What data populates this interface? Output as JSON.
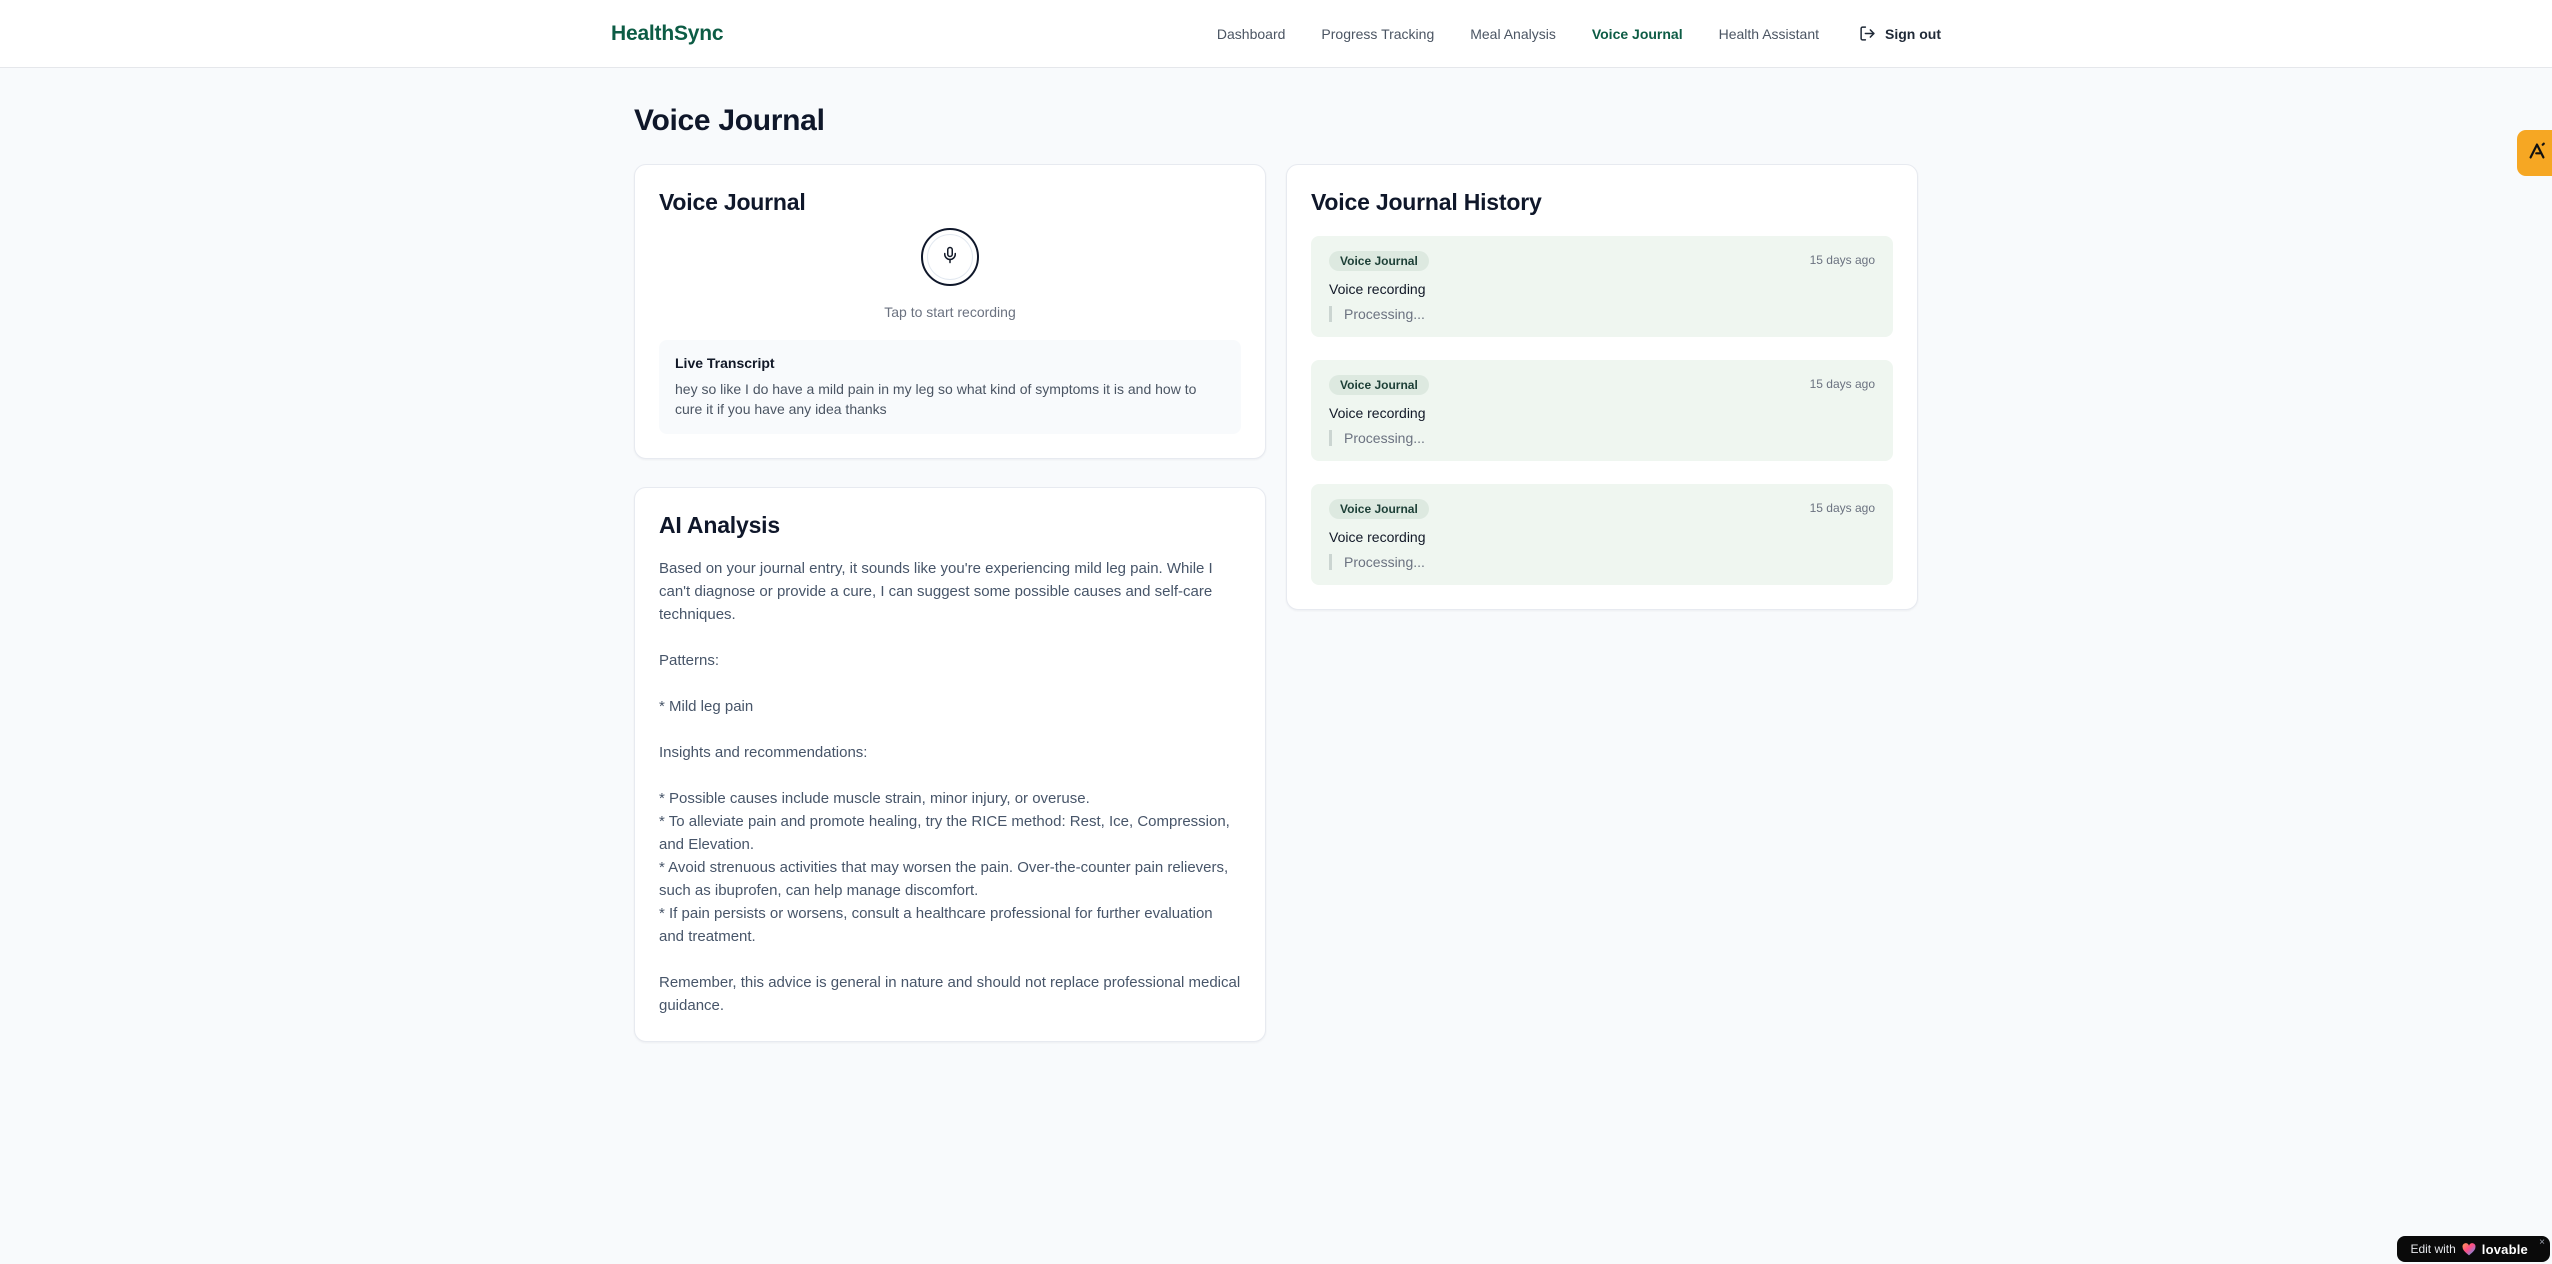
{
  "header": {
    "logo": "HealthSync",
    "nav": [
      {
        "label": "Dashboard",
        "active": false
      },
      {
        "label": "Progress Tracking",
        "active": false
      },
      {
        "label": "Meal Analysis",
        "active": false
      },
      {
        "label": "Voice Journal",
        "active": true
      },
      {
        "label": "Health Assistant",
        "active": false
      }
    ],
    "sign_out_label": "Sign out"
  },
  "page": {
    "title": "Voice Journal"
  },
  "recorder_card": {
    "title": "Voice Journal",
    "tap_hint": "Tap to start recording",
    "live_transcript_label": "Live Transcript",
    "transcript": "hey so like I do have a mild pain in my leg so what kind of symptoms it is and how to cure it if you have any idea thanks"
  },
  "analysis_card": {
    "title": "AI Analysis",
    "body": "Based on your journal entry, it sounds like you're experiencing mild leg pain. While I can't diagnose or provide a cure, I can suggest some possible causes and self-care techniques.\n\nPatterns:\n\n* Mild leg pain\n\nInsights and recommendations:\n\n* Possible causes include muscle strain, minor injury, or overuse.\n* To alleviate pain and promote healing, try the RICE method: Rest, Ice, Compression, and Elevation.\n* Avoid strenuous activities that may worsen the pain. Over-the-counter pain relievers, such as ibuprofen, can help manage discomfort.\n* If pain persists or worsens, consult a healthcare professional for further evaluation and treatment.\n\nRemember, this advice is general in nature and should not replace professional medical guidance."
  },
  "history_card": {
    "title": "Voice Journal History",
    "entries": [
      {
        "badge": "Voice Journal",
        "time": "15 days ago",
        "label": "Voice recording",
        "status": "Processing..."
      },
      {
        "badge": "Voice Journal",
        "time": "15 days ago",
        "label": "Voice recording",
        "status": "Processing..."
      },
      {
        "badge": "Voice Journal",
        "time": "15 days ago",
        "label": "Voice recording",
        "status": "Processing..."
      }
    ]
  },
  "floating": {
    "lovable": {
      "prefix": "Edit with",
      "brand": "lovable",
      "close": "×"
    }
  },
  "colors": {
    "brand_green": "#0d5c45",
    "page_bg": "#f8fafc",
    "entry_bg": "#eff6f0",
    "badge_bg": "#dde9e0",
    "badge_text": "#1c3f36",
    "amber_badge": "#f6a723"
  }
}
